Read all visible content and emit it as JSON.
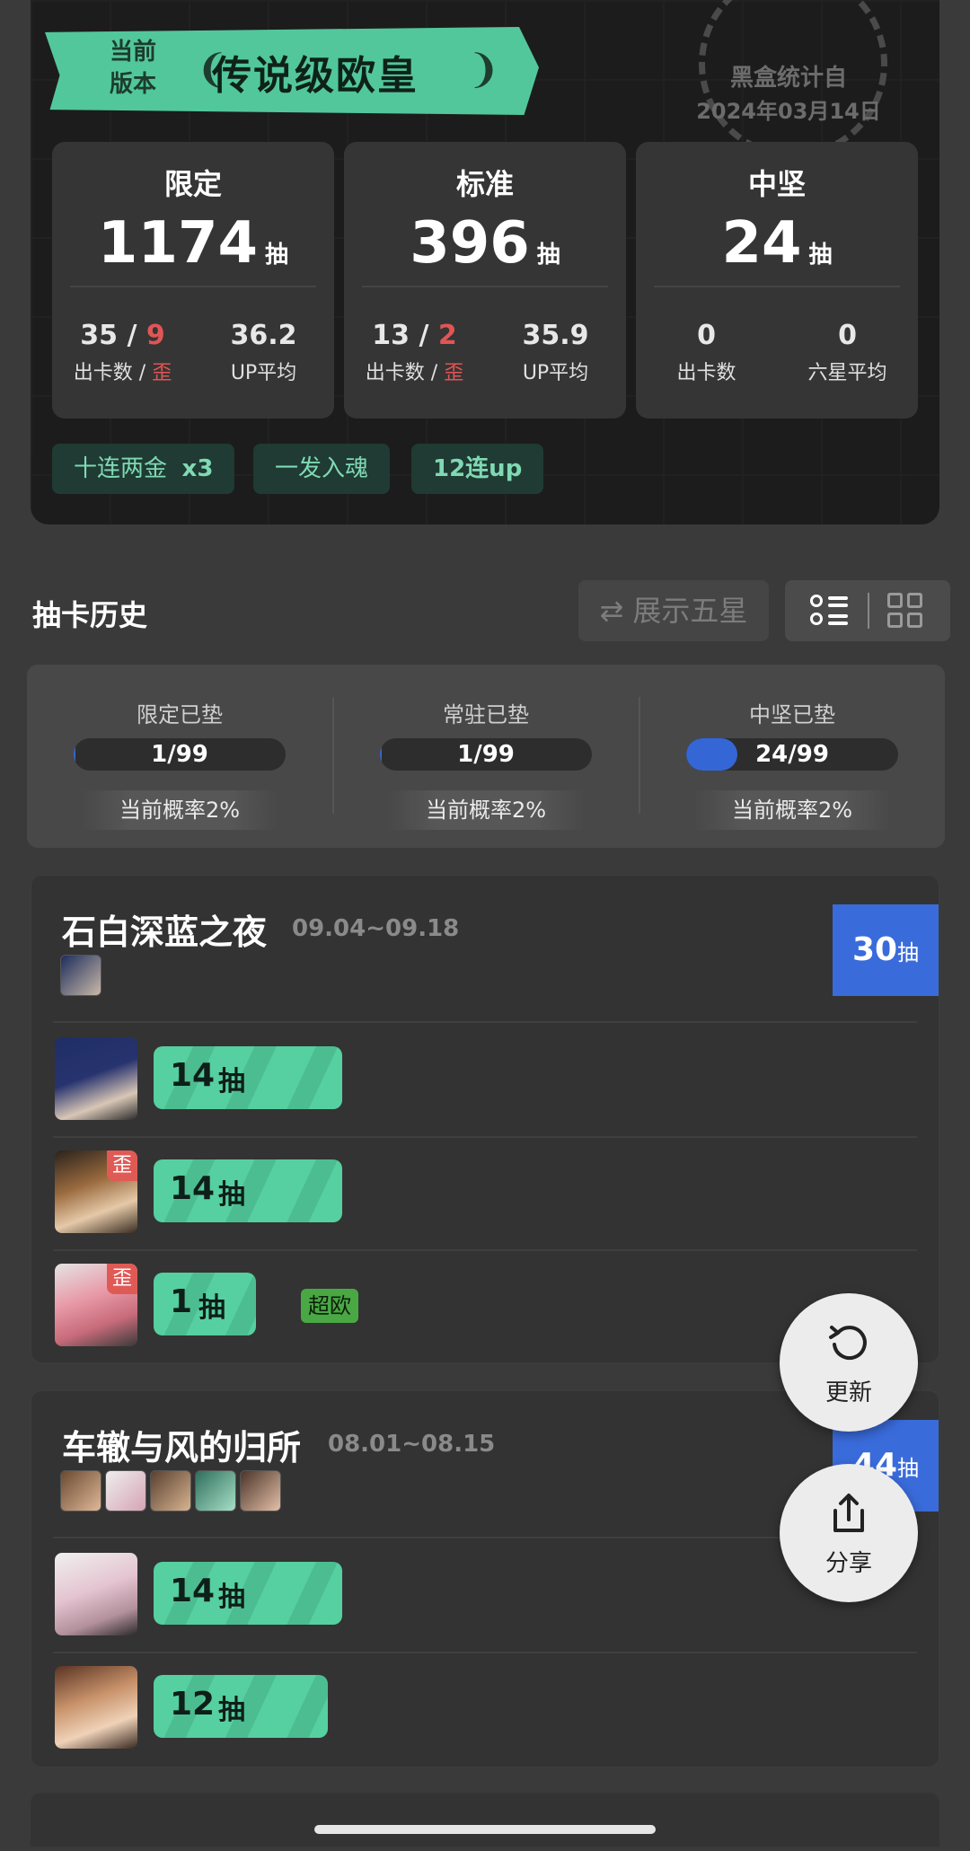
{
  "stamp": {
    "line1": "黑盒统计自",
    "line2": "2024年03月14日"
  },
  "banner": {
    "subtitle_line1": "当前",
    "subtitle_line2": "版本",
    "title": "传说级欧皇"
  },
  "stats": [
    {
      "label": "限定",
      "total": "1174",
      "unit": "抽",
      "left_value": "35",
      "left_sep": " / ",
      "left_extra": "9",
      "left_caption": "出卡数 / ",
      "left_caption_extra": "歪",
      "right_value": "36.2",
      "right_caption": "UP平均"
    },
    {
      "label": "标准",
      "total": "396",
      "unit": "抽",
      "left_value": "13",
      "left_sep": " / ",
      "left_extra": "2",
      "left_caption": "出卡数 / ",
      "left_caption_extra": "歪",
      "right_value": "35.9",
      "right_caption": "UP平均"
    },
    {
      "label": "中坚",
      "total": "24",
      "unit": "抽",
      "left_value": "0",
      "left_sep": "",
      "left_extra": "",
      "left_caption": "出卡数",
      "left_caption_extra": "",
      "right_value": "0",
      "right_caption": "六星平均"
    }
  ],
  "chips": [
    {
      "text": "十连两金",
      "suffix": "x3"
    },
    {
      "text": "一发入魂",
      "suffix": ""
    },
    {
      "text": "12连up",
      "suffix": ""
    }
  ],
  "history": {
    "title": "抽卡历史",
    "show_five_star": "展示五星",
    "swap_icon": "⇄"
  },
  "pity": [
    {
      "name": "限定已垫",
      "value": "1/99",
      "progress": 0.0101,
      "rate": "当前概率2%"
    },
    {
      "name": "常驻已垫",
      "value": "1/99",
      "progress": 0.0101,
      "rate": "当前概率2%"
    },
    {
      "name": "中坚已垫",
      "value": "24/99",
      "progress": 0.2424,
      "rate": "当前概率2%"
    }
  ],
  "banners": [
    {
      "title": "石白深蓝之夜",
      "date": "09.04~09.18",
      "count": "30",
      "unit": "抽",
      "rows": [
        {
          "pulls": "14",
          "unit": "抽",
          "tag": "",
          "badge": ""
        },
        {
          "pulls": "14",
          "unit": "抽",
          "tag": "歪",
          "badge": ""
        },
        {
          "pulls": "1",
          "unit": "抽",
          "tag": "歪",
          "badge": "超欧"
        }
      ]
    },
    {
      "title": "车辙与风的归所",
      "date": "08.01~08.15",
      "count": "44",
      "unit": "抽",
      "rows": [
        {
          "pulls": "14",
          "unit": "抽",
          "tag": "",
          "badge": ""
        },
        {
          "pulls": "12",
          "unit": "抽",
          "tag": "",
          "badge": ""
        }
      ]
    }
  ],
  "fab": {
    "refresh_label": "更新",
    "share_label": "分享"
  },
  "colors": {
    "accent_green": "#52c79b",
    "accent_blue": "#3a6bdb",
    "warn_red": "#e05555"
  }
}
